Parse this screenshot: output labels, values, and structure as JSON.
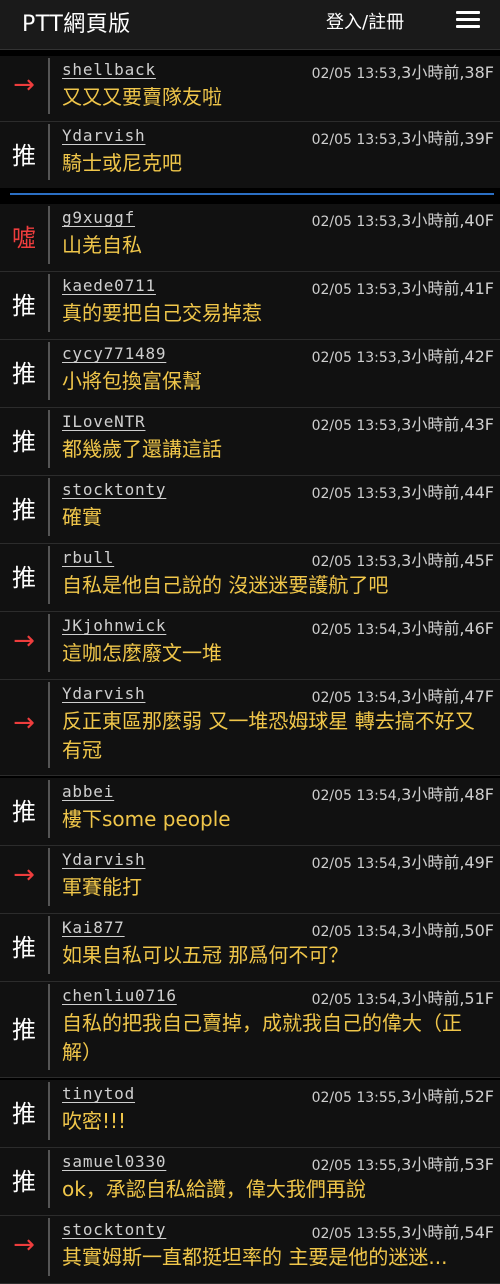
{
  "header": {
    "brand": "PTT網頁版",
    "login": "登入/註冊"
  },
  "pushes": [
    {
      "tag": "→",
      "user": "shellback",
      "time": "02/05 13:53,",
      "ago": "3小時前",
      "floor": ",38F",
      "content": "又又又要賣隊友啦"
    },
    {
      "tag": "推",
      "user": "Ydarvish",
      "time": "02/05 13:53,",
      "ago": "3小時前",
      "floor": ",39F",
      "content": "騎士或尼克吧"
    },
    {
      "tag": "噓",
      "user": "g9xuggf",
      "time": "02/05 13:53,",
      "ago": "3小時前",
      "floor": ",40F",
      "content": "山羌自私"
    },
    {
      "tag": "推",
      "user": "kaede0711",
      "time": "02/05 13:53,",
      "ago": "3小時前",
      "floor": ",41F",
      "content": "真的要把自己交易掉惹"
    },
    {
      "tag": "推",
      "user": "cycy771489",
      "time": "02/05 13:53,",
      "ago": "3小時前",
      "floor": ",42F",
      "content": "小將包換富保幫"
    },
    {
      "tag": "推",
      "user": "ILoveNTR",
      "time": "02/05 13:53,",
      "ago": "3小時前",
      "floor": ",43F",
      "content": "都幾歲了還講這話"
    },
    {
      "tag": "推",
      "user": "stocktonty",
      "time": "02/05 13:53,",
      "ago": "3小時前",
      "floor": ",44F",
      "content": "確實"
    },
    {
      "tag": "推",
      "user": "rbull",
      "time": "02/05 13:53,",
      "ago": "3小時前",
      "floor": ",45F",
      "content": "自私是他自己說的 沒迷迷要護航了吧"
    },
    {
      "tag": "→",
      "user": "JKjohnwick",
      "time": "02/05 13:54,",
      "ago": "3小時前",
      "floor": ",46F",
      "content": "這咖怎麼廢文一堆"
    },
    {
      "tag": "→",
      "user": "Ydarvish",
      "time": "02/05 13:54,",
      "ago": "3小時前",
      "floor": ",47F",
      "content": "反正東區那麼弱 又一堆恐姆球星 轉去搞不好又有冠"
    },
    {
      "tag": "推",
      "user": "abbei",
      "time": "02/05 13:54,",
      "ago": "3小時前",
      "floor": ",48F",
      "content": "樓下some people"
    },
    {
      "tag": "→",
      "user": "Ydarvish",
      "time": "02/05 13:54,",
      "ago": "3小時前",
      "floor": ",49F",
      "content": "軍賽能打"
    },
    {
      "tag": "推",
      "user": "Kai877",
      "time": "02/05 13:54,",
      "ago": "3小時前",
      "floor": ",50F",
      "content": "如果自私可以五冠 那爲何不可？"
    },
    {
      "tag": "推",
      "user": "chenliu0716",
      "time": "02/05 13:54,",
      "ago": "3小時前",
      "floor": ",51F",
      "content": "自私的把我自己賣掉，成就我自己的偉大（正解）"
    },
    {
      "tag": "推",
      "user": "tinytod",
      "time": "02/05 13:55,",
      "ago": "3小時前",
      "floor": ",52F",
      "content": "吹密!!!"
    },
    {
      "tag": "推",
      "user": "samuel0330",
      "time": "02/05 13:55,",
      "ago": "3小時前",
      "floor": ",53F",
      "content": "ok，承認自私給讚，偉大我們再說"
    },
    {
      "tag": "→",
      "user": "stocktonty",
      "time": "02/05 13:55,",
      "ago": "3小時前",
      "floor": ",54F",
      "content": "其實姆斯一直都挺坦率的 主要是他的迷迷..."
    }
  ]
}
